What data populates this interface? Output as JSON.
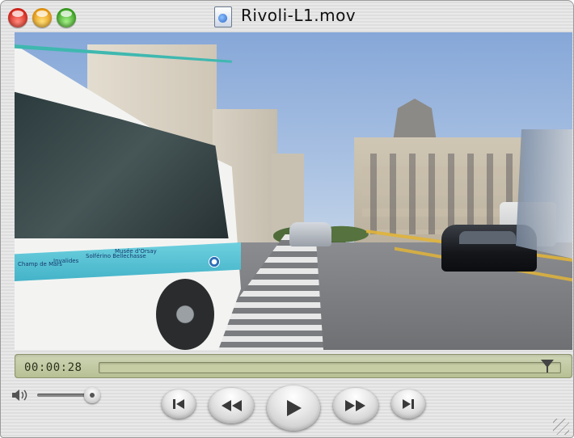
{
  "window": {
    "title": "Rivoli-L1.mov",
    "file_icon": "quicktime-movie-icon"
  },
  "titlebar_buttons": {
    "close": "close-icon",
    "minimize": "minimize-icon",
    "zoom": "zoom-icon"
  },
  "video": {
    "bus_text": [
      "Champ de Mars",
      "Invalides",
      "Solférino Bellechasse",
      "Musée d'Orsay"
    ]
  },
  "playback": {
    "current_time": "00:00:28",
    "progress_fraction": 0.97,
    "volume_fraction": 0.95
  },
  "controls": {
    "goto_start": "skip-to-start-icon",
    "rewind": "rewind-icon",
    "play": "play-icon",
    "fast_forward": "fast-forward-icon",
    "goto_end": "skip-to-end-icon",
    "volume": "speaker-icon"
  },
  "colors": {
    "timebar_bg": "#cfd6b7",
    "close_button": "#d9271c",
    "minimize_button": "#e99a12",
    "zoom_button": "#3aa321",
    "bus_accent": "#3fb8b0"
  }
}
